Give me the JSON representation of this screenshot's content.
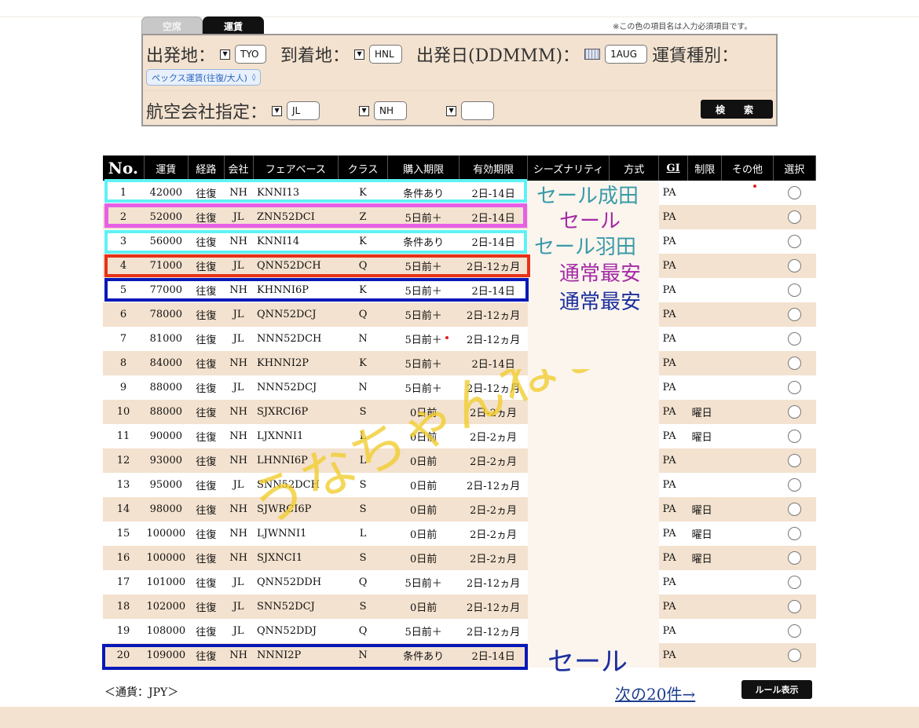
{
  "tabs": [
    {
      "label": "空席"
    },
    {
      "label": "運賃"
    }
  ],
  "required_note": "※この色の項目名は入力必須項目です。",
  "search_form": {
    "origin_label": "出発地：",
    "origin_value": "TYO",
    "dest_label": "到着地：",
    "dest_value": "HNL",
    "date_label": "出発日(DDMMM)：",
    "date_value": "1AUG",
    "faretype_label": "運賃種別：",
    "faretype_value": "ペックス運賃(往復/大人)",
    "airline_label": "航空会社指定：",
    "airline_values": [
      "JL",
      "NH",
      ""
    ],
    "search_button": "検　索"
  },
  "table": {
    "headers": [
      "No.",
      "運賃",
      "経路",
      "会社",
      "フェアベース",
      "クラス",
      "購入期限",
      "有効期限",
      "シーズナリティ",
      "方式",
      "GI",
      "制限",
      "その他",
      "選択"
    ],
    "rows": [
      {
        "no": "1",
        "fare": "42000",
        "route": "往復",
        "carrier": "NH",
        "farebase": "KNNI13",
        "class": "K",
        "purchase": "条件あり",
        "validity": "2日-14日",
        "gi": "PA",
        "restriction": ""
      },
      {
        "no": "2",
        "fare": "52000",
        "route": "往復",
        "carrier": "JL",
        "farebase": "ZNN52DCI",
        "class": "Z",
        "purchase": "5日前＋",
        "validity": "2日-14日",
        "gi": "PA",
        "restriction": ""
      },
      {
        "no": "3",
        "fare": "56000",
        "route": "往復",
        "carrier": "NH",
        "farebase": "KNNI14",
        "class": "K",
        "purchase": "条件あり",
        "validity": "2日-14日",
        "gi": "PA",
        "restriction": ""
      },
      {
        "no": "4",
        "fare": "71000",
        "route": "往復",
        "carrier": "JL",
        "farebase": "QNN52DCH",
        "class": "Q",
        "purchase": "5日前＋",
        "validity": "2日-12ヵ月",
        "gi": "PA",
        "restriction": ""
      },
      {
        "no": "5",
        "fare": "77000",
        "route": "往復",
        "carrier": "NH",
        "farebase": "KHNNI6P",
        "class": "K",
        "purchase": "5日前＋",
        "validity": "2日-14日",
        "gi": "PA",
        "restriction": ""
      },
      {
        "no": "6",
        "fare": "78000",
        "route": "往復",
        "carrier": "JL",
        "farebase": "QNN52DCJ",
        "class": "Q",
        "purchase": "5日前＋",
        "validity": "2日-12ヵ月",
        "gi": "PA",
        "restriction": ""
      },
      {
        "no": "7",
        "fare": "81000",
        "route": "往復",
        "carrier": "JL",
        "farebase": "NNN52DCH",
        "class": "N",
        "purchase": "5日前＋",
        "validity": "2日-12ヵ月",
        "gi": "PA",
        "restriction": ""
      },
      {
        "no": "8",
        "fare": "84000",
        "route": "往復",
        "carrier": "NH",
        "farebase": "KHNNI2P",
        "class": "K",
        "purchase": "5日前＋",
        "validity": "2日-14日",
        "gi": "PA",
        "restriction": ""
      },
      {
        "no": "9",
        "fare": "88000",
        "route": "往復",
        "carrier": "JL",
        "farebase": "NNN52DCJ",
        "class": "N",
        "purchase": "5日前＋",
        "validity": "2日-12ヵ月",
        "gi": "PA",
        "restriction": ""
      },
      {
        "no": "10",
        "fare": "88000",
        "route": "往復",
        "carrier": "NH",
        "farebase": "SJXRCI6P",
        "class": "S",
        "purchase": "0日前",
        "validity": "2日-2ヵ月",
        "gi": "PA",
        "restriction": "曜日"
      },
      {
        "no": "11",
        "fare": "90000",
        "route": "往復",
        "carrier": "NH",
        "farebase": "LJXNNI1",
        "class": "L",
        "purchase": "0日前",
        "validity": "2日-2ヵ月",
        "gi": "PA",
        "restriction": "曜日"
      },
      {
        "no": "12",
        "fare": "93000",
        "route": "往復",
        "carrier": "NH",
        "farebase": "LHNNI6P",
        "class": "L",
        "purchase": "0日前",
        "validity": "2日-2ヵ月",
        "gi": "PA",
        "restriction": ""
      },
      {
        "no": "13",
        "fare": "95000",
        "route": "往復",
        "carrier": "JL",
        "farebase": "SNN52DCH",
        "class": "S",
        "purchase": "0日前",
        "validity": "2日-12ヵ月",
        "gi": "PA",
        "restriction": ""
      },
      {
        "no": "14",
        "fare": "98000",
        "route": "往復",
        "carrier": "NH",
        "farebase": "SJWRCI6P",
        "class": "S",
        "purchase": "0日前",
        "validity": "2日-2ヵ月",
        "gi": "PA",
        "restriction": "曜日"
      },
      {
        "no": "15",
        "fare": "100000",
        "route": "往復",
        "carrier": "NH",
        "farebase": "LJWNNI1",
        "class": "L",
        "purchase": "0日前",
        "validity": "2日-2ヵ月",
        "gi": "PA",
        "restriction": "曜日"
      },
      {
        "no": "16",
        "fare": "100000",
        "route": "往復",
        "carrier": "NH",
        "farebase": "SJXNCI1",
        "class": "S",
        "purchase": "0日前",
        "validity": "2日-2ヵ月",
        "gi": "PA",
        "restriction": "曜日"
      },
      {
        "no": "17",
        "fare": "101000",
        "route": "往復",
        "carrier": "JL",
        "farebase": "QNN52DDH",
        "class": "Q",
        "purchase": "5日前＋",
        "validity": "2日-12ヵ月",
        "gi": "PA",
        "restriction": ""
      },
      {
        "no": "18",
        "fare": "102000",
        "route": "往復",
        "carrier": "JL",
        "farebase": "SNN52DCJ",
        "class": "S",
        "purchase": "0日前",
        "validity": "2日-12ヵ月",
        "gi": "PA",
        "restriction": ""
      },
      {
        "no": "19",
        "fare": "108000",
        "route": "往復",
        "carrier": "JL",
        "farebase": "QNN52DDJ",
        "class": "Q",
        "purchase": "5日前＋",
        "validity": "2日-12ヵ月",
        "gi": "PA",
        "restriction": ""
      },
      {
        "no": "20",
        "fare": "109000",
        "route": "往復",
        "carrier": "NH",
        "farebase": "NNNI2P",
        "class": "N",
        "purchase": "条件あり",
        "validity": "2日-14日",
        "gi": "PA",
        "restriction": ""
      }
    ]
  },
  "annotations": [
    {
      "text": "セール成田",
      "color": "#3a9aa8"
    },
    {
      "text": "セール",
      "color": "#a52aa5"
    },
    {
      "text": "セール羽田",
      "color": "#3a9aa8"
    },
    {
      "text": "通常最安",
      "color": "#a52aa5"
    },
    {
      "text": "通常最安",
      "color": "#1c2f9e"
    },
    {
      "text": "セール",
      "color": "#1c2f9e"
    }
  ],
  "highlight_colors": {
    "cyan": "#5ff2f5",
    "magenta": "#e660e6",
    "red": "#e8311a",
    "blue": "#0818b8"
  },
  "watermark": "うなちゃんねる。",
  "footer": {
    "currency": "＜通貨：JPY＞",
    "next_link": "次の20件→",
    "rule_button": "ルール表示"
  }
}
